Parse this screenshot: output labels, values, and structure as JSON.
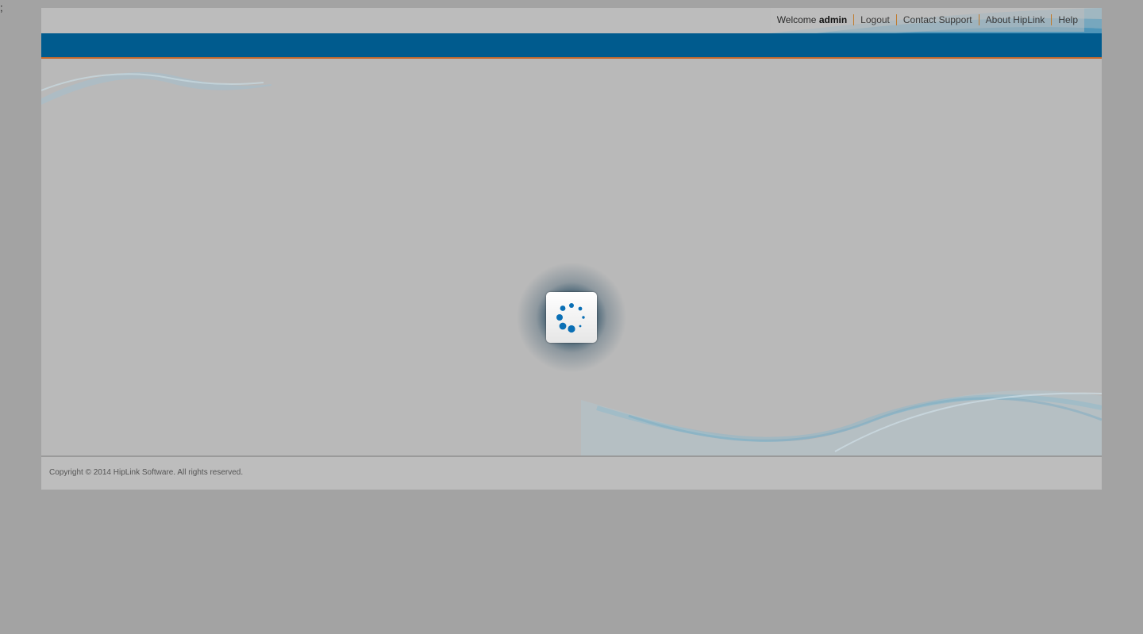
{
  "stray_text": ";",
  "header": {
    "welcome_prefix": "Welcome",
    "username": "admin",
    "links": {
      "logout": "Logout",
      "contact_support": "Contact Support",
      "about": "About HipLink",
      "help": "Help"
    }
  },
  "colors": {
    "navbar": "#005b8e",
    "navbar_border": "#c4692e",
    "spinner": "#0a6fb5"
  },
  "loader": {
    "icon": "loading-spinner-icon"
  },
  "footer": {
    "copyright": "Copyright © 2014 HipLink Software. All rights reserved."
  }
}
